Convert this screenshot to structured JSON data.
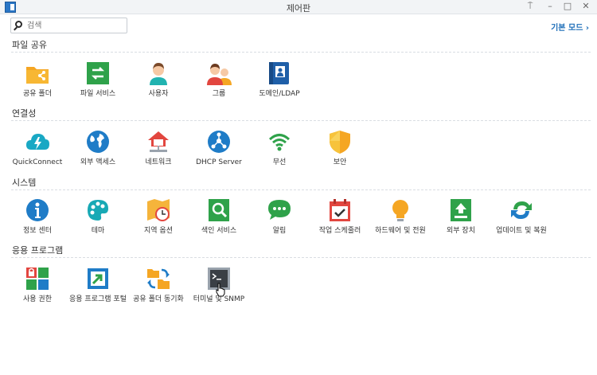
{
  "window": {
    "title": "제어판",
    "controls": [
      "pin",
      "minimize",
      "maximize",
      "close"
    ]
  },
  "search": {
    "placeholder": "검색"
  },
  "mode_link": "기본 모드 ›",
  "sections": [
    {
      "title": "파일 공유",
      "items": [
        {
          "label": "공유 폴더",
          "icon": "shared-folder-icon"
        },
        {
          "label": "파일 서비스",
          "icon": "file-services-icon"
        },
        {
          "label": "사용자",
          "icon": "user-icon"
        },
        {
          "label": "그룹",
          "icon": "group-icon"
        },
        {
          "label": "도메인/LDAP",
          "icon": "domain-ldap-icon"
        }
      ]
    },
    {
      "title": "연결성",
      "items": [
        {
          "label": "QuickConnect",
          "icon": "quickconnect-icon"
        },
        {
          "label": "외부 액세스",
          "icon": "external-access-icon"
        },
        {
          "label": "네트워크",
          "icon": "network-icon"
        },
        {
          "label": "DHCP Server",
          "icon": "dhcp-server-icon"
        },
        {
          "label": "무선",
          "icon": "wireless-icon"
        },
        {
          "label": "보안",
          "icon": "security-shield-icon"
        }
      ]
    },
    {
      "title": "시스템",
      "items": [
        {
          "label": "정보 센터",
          "icon": "info-center-icon"
        },
        {
          "label": "테마",
          "icon": "theme-palette-icon"
        },
        {
          "label": "지역 옵션",
          "icon": "regional-options-icon"
        },
        {
          "label": "색인 서비스",
          "icon": "indexing-service-icon"
        },
        {
          "label": "알림",
          "icon": "notification-icon"
        },
        {
          "label": "작업 스케줄러",
          "icon": "task-scheduler-icon"
        },
        {
          "label": "하드웨어 및 전원",
          "icon": "hardware-power-icon"
        },
        {
          "label": "외부 장치",
          "icon": "external-devices-icon"
        },
        {
          "label": "업데이트 및 복원",
          "icon": "update-restore-icon"
        }
      ]
    },
    {
      "title": "응용 프로그램",
      "items": [
        {
          "label": "사용 권한",
          "icon": "privileges-icon"
        },
        {
          "label": "응용 프로그램 포털",
          "icon": "application-portal-icon"
        },
        {
          "label": "공유 폴더 동기화",
          "icon": "shared-folder-sync-icon"
        },
        {
          "label": "터미널 및 SNMP",
          "icon": "terminal-snmp-icon"
        }
      ]
    }
  ],
  "colors": {
    "accent": "#1f6fb9",
    "orange": "#f5a623",
    "green": "#2fa24a",
    "teal": "#18a9b5",
    "blue": "#1f7cc7"
  }
}
